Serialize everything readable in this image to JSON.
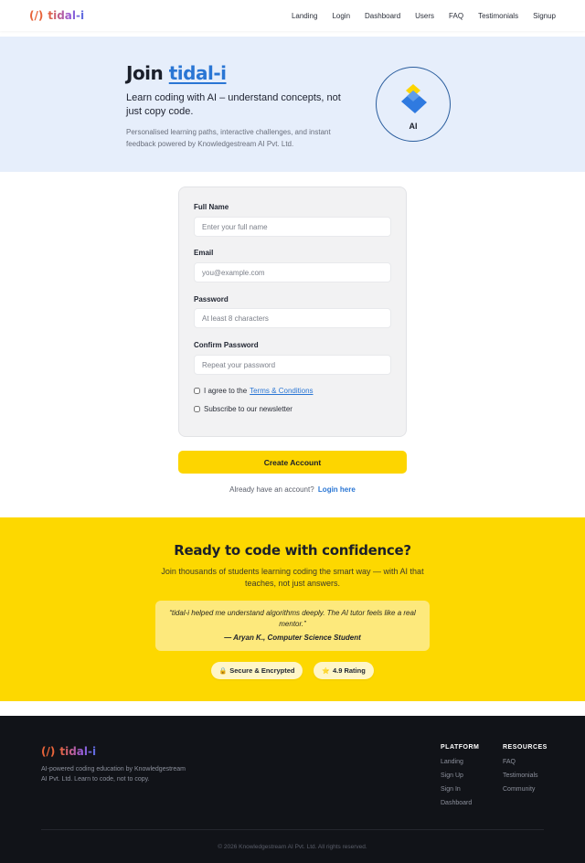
{
  "brand": {
    "mark": "(/)",
    "name": "tidal-i"
  },
  "nav": {
    "links": [
      "Landing",
      "Login",
      "Dashboard",
      "Users",
      "FAQ",
      "Testimonials",
      "Signup"
    ]
  },
  "hero": {
    "title_prefix": "Join",
    "title_brand": "tidal-i",
    "subtitle": "Learn coding with AI – understand concepts, not just copy code.",
    "description": "Personalised learning paths, interactive challenges, and instant feedback powered by Knowledgestream AI Pvt. Ltd.",
    "badge_label": "AI"
  },
  "form": {
    "full_name": {
      "label": "Full Name",
      "placeholder": "Enter your full name"
    },
    "email": {
      "label": "Email",
      "placeholder": "you@example.com"
    },
    "password": {
      "label": "Password",
      "placeholder": "At least 8 characters"
    },
    "confirm": {
      "label": "Confirm Password",
      "placeholder": "Repeat your password"
    },
    "terms_text": "I agree to the",
    "terms_link": "Terms & Conditions",
    "newsletter_text": "Subscribe to our newsletter",
    "submit_label": "Create Account",
    "already_text": "Already have an account?",
    "login_link": "Login here"
  },
  "cta": {
    "title": "Ready to code with confidence?",
    "subtitle": "Join thousands of students learning coding the smart way — with AI that teaches, not just answers.",
    "quote": "“tidal-i helped me understand algorithms deeply. The AI tutor feels like a real mentor.”",
    "quote_author": "— Aryan K., Computer Science Student",
    "badges": [
      {
        "icon": "lock-icon",
        "glyph": "🔒",
        "label": "Secure & Encrypted"
      },
      {
        "icon": "star-icon",
        "glyph": "⭐",
        "label": "4.9 Rating"
      }
    ]
  },
  "footer": {
    "description": "AI-powered coding education by Knowledgestream AI Pvt. Ltd. Learn to code, not to copy.",
    "platform": {
      "title": "PLATFORM",
      "links": [
        "Landing",
        "Sign Up",
        "Sign In",
        "Dashboard"
      ]
    },
    "resources": {
      "title": "RESOURCES",
      "links": [
        "FAQ",
        "Testimonials",
        "Community"
      ]
    },
    "copyright": "© 2026 Knowledgestream AI Pvt. Ltd. All rights reserved."
  },
  "colors": {
    "accent_blue": "#2a76d4",
    "cta_yellow": "#fdd800",
    "hero_bg": "#e6eefb",
    "footer_bg": "#111318"
  }
}
